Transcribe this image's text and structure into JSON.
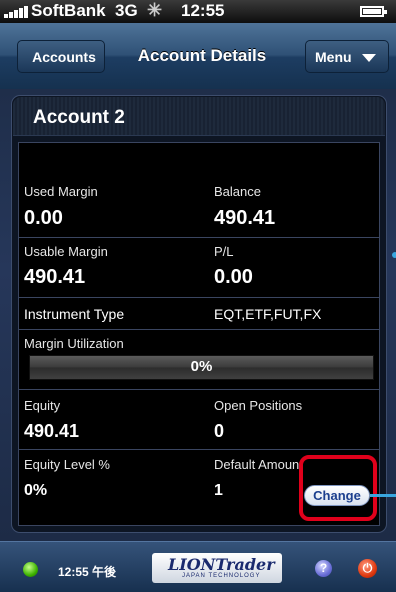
{
  "status_bar": {
    "carrier": "SoftBank",
    "network": "3G",
    "time": "12:55"
  },
  "nav": {
    "back_label": "Accounts",
    "title": "Account Details",
    "menu_label": "Menu"
  },
  "account": {
    "name": "Account 2",
    "fields": {
      "used_margin": {
        "label": "Used Margin",
        "value": "0.00"
      },
      "balance": {
        "label": "Balance",
        "value": "490.41"
      },
      "usable_margin": {
        "label": "Usable Margin",
        "value": "490.41"
      },
      "pl": {
        "label": "P/L",
        "value": "0.00"
      },
      "instrument_type": {
        "label": "Instrument Type",
        "value": "EQT,ETF,FUT,FX"
      },
      "margin_utilization": {
        "label": "Margin Utilization",
        "value": "0%",
        "fraction": 0
      },
      "equity": {
        "label": "Equity",
        "value": "490.41"
      },
      "open_positions": {
        "label": "Open Positions",
        "value": "0"
      },
      "equity_level": {
        "label": "Equity Level %",
        "value": "0%"
      },
      "default_amount": {
        "label": "Default Amount",
        "value": "1"
      }
    },
    "change_label": "Change"
  },
  "toolbar": {
    "time": "12:55 午後",
    "logo_text": "LIONTrader",
    "logo_sub": "JAPAN TECHNOLOGY",
    "help_symbol": "?",
    "power_symbol": "⏻"
  },
  "colors": {
    "nav_blue": "#2f5176",
    "highlight_red": "#e0001b",
    "change_text": "#1c3f8e"
  },
  "icons": [
    "signal-icon",
    "spinner-icon",
    "battery-icon",
    "connection-status-icon",
    "help-icon",
    "power-icon"
  ]
}
